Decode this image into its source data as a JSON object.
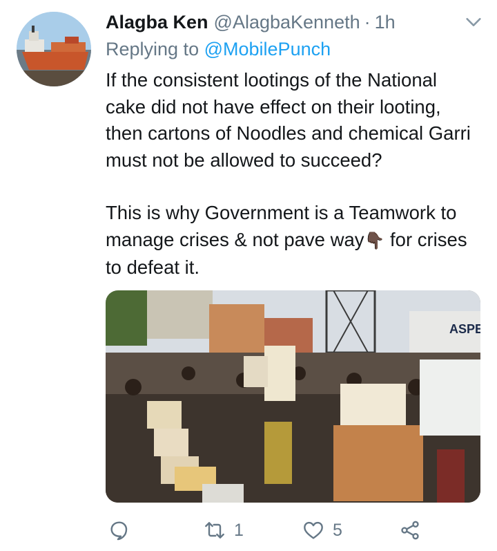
{
  "tweet": {
    "author_name": "Alagba Ken",
    "author_handle": "@AlagbaKenneth",
    "separator": "·",
    "time": "1h",
    "replying_prefix": "Replying to",
    "replying_to": "@MobilePunch",
    "paragraph1": "If the consistent lootings of the National cake did not have effect on their looting, then cartons of Noodles and chemical Garri must not be allowed to succeed?",
    "paragraph2_before": "This is why Government is a Teamwork to manage crises & not pave way",
    "paragraph2_emoji": "👇🏿",
    "paragraph2_after": " for crises to defeat it.",
    "photo_sign_text": "ASPE"
  },
  "actions": {
    "reply_count": "",
    "retweet_count": "1",
    "like_count": "5"
  },
  "icons": [
    "ship-avatar",
    "chevron-down-icon",
    "reply-icon",
    "retweet-icon",
    "like-icon",
    "share-icon"
  ],
  "colors": {
    "link": "#1da1f2",
    "secondary": "#657786",
    "text": "#14171a"
  }
}
